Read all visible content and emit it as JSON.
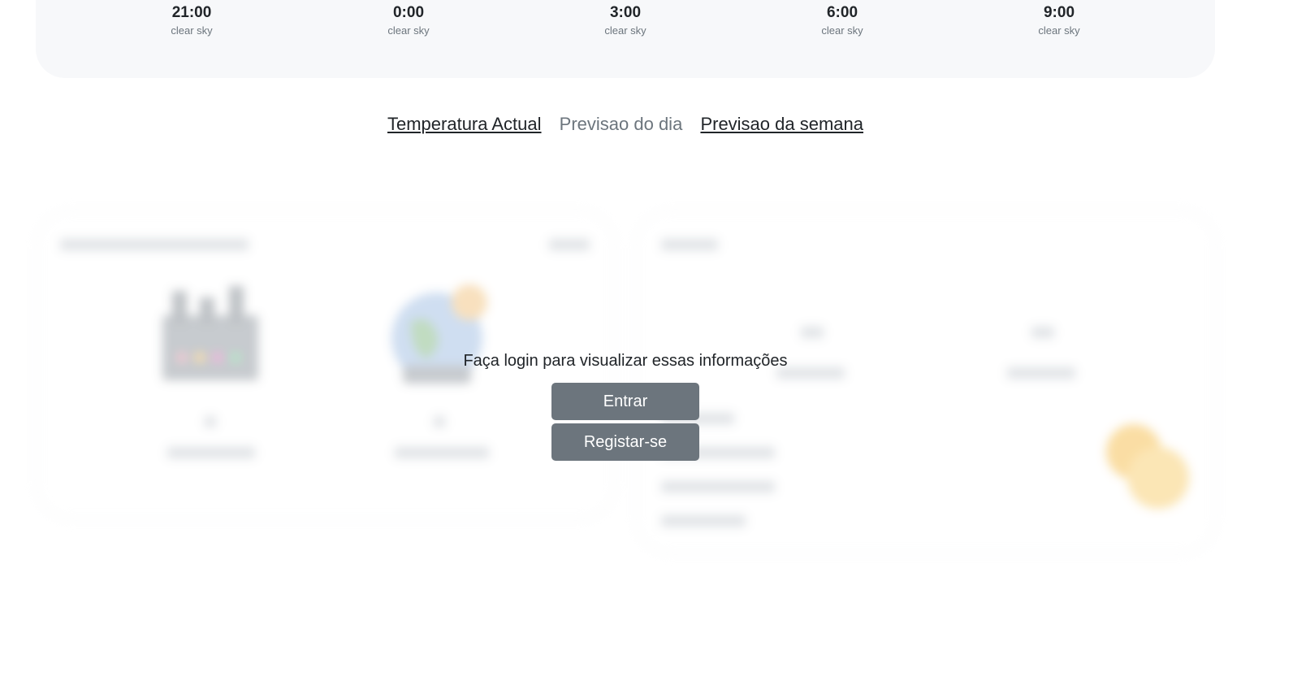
{
  "forecast": [
    {
      "time": "21:00",
      "desc": "clear sky"
    },
    {
      "time": "0:00",
      "desc": "clear sky"
    },
    {
      "time": "3:00",
      "desc": "clear sky"
    },
    {
      "time": "6:00",
      "desc": "clear sky"
    },
    {
      "time": "9:00",
      "desc": "clear sky"
    }
  ],
  "tabs": {
    "current": "Temperatura Actual",
    "daily": "Previsao do dia",
    "weekly": "Previsao da semana"
  },
  "overlay": {
    "message": "Faça login para visualizar essas informações",
    "login_label": "Entrar",
    "register_label": "Registar-se"
  },
  "colors": {
    "button_bg": "#6c757d",
    "card_bg": "#f7f8fa",
    "muted_text": "#6c757d"
  },
  "icons": [
    "factory-icon",
    "globe-icon",
    "sun-icon"
  ]
}
